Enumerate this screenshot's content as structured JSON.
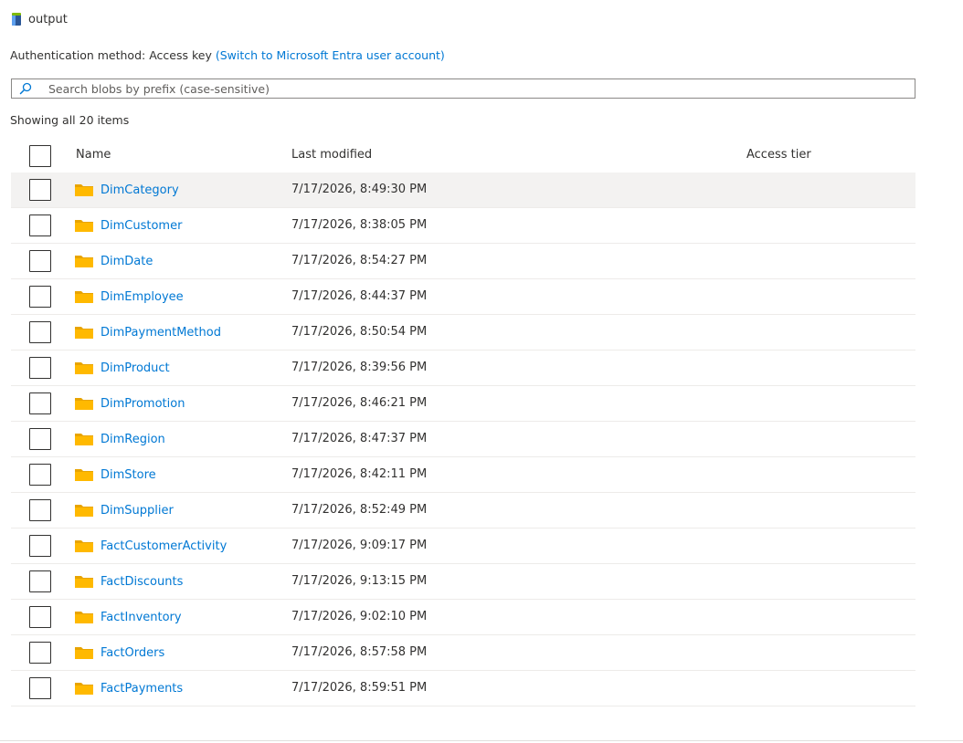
{
  "container": {
    "name": "output",
    "icon": "storage-container-icon"
  },
  "auth": {
    "label": "Authentication method:",
    "value": "Access key",
    "switch_link": "(Switch to Microsoft Entra user account)"
  },
  "search": {
    "placeholder": "Search blobs by prefix (case-sensitive)",
    "value": ""
  },
  "status": {
    "showing": "Showing all 20 items"
  },
  "columns": {
    "name": "Name",
    "last_modified": "Last modified",
    "access_tier": "Access tier"
  },
  "rows": [
    {
      "name": "DimCategory",
      "modified": "7/17/2026, 8:49:30 PM",
      "tier": ""
    },
    {
      "name": "DimCustomer",
      "modified": "7/17/2026, 8:38:05 PM",
      "tier": ""
    },
    {
      "name": "DimDate",
      "modified": "7/17/2026, 8:54:27 PM",
      "tier": ""
    },
    {
      "name": "DimEmployee",
      "modified": "7/17/2026, 8:44:37 PM",
      "tier": ""
    },
    {
      "name": "DimPaymentMethod",
      "modified": "7/17/2026, 8:50:54 PM",
      "tier": ""
    },
    {
      "name": "DimProduct",
      "modified": "7/17/2026, 8:39:56 PM",
      "tier": ""
    },
    {
      "name": "DimPromotion",
      "modified": "7/17/2026, 8:46:21 PM",
      "tier": ""
    },
    {
      "name": "DimRegion",
      "modified": "7/17/2026, 8:47:37 PM",
      "tier": ""
    },
    {
      "name": "DimStore",
      "modified": "7/17/2026, 8:42:11 PM",
      "tier": ""
    },
    {
      "name": "DimSupplier",
      "modified": "7/17/2026, 8:52:49 PM",
      "tier": ""
    },
    {
      "name": "FactCustomerActivity",
      "modified": "7/17/2026, 9:09:17 PM",
      "tier": ""
    },
    {
      "name": "FactDiscounts",
      "modified": "7/17/2026, 9:13:15 PM",
      "tier": ""
    },
    {
      "name": "FactInventory",
      "modified": "7/17/2026, 9:02:10 PM",
      "tier": ""
    },
    {
      "name": "FactOrders",
      "modified": "7/17/2026, 8:57:58 PM",
      "tier": ""
    },
    {
      "name": "FactPayments",
      "modified": "7/17/2026, 8:59:51 PM",
      "tier": ""
    }
  ],
  "colors": {
    "link": "#0078d4",
    "folder": "#ffb900",
    "hover_row": "#f3f2f1"
  }
}
